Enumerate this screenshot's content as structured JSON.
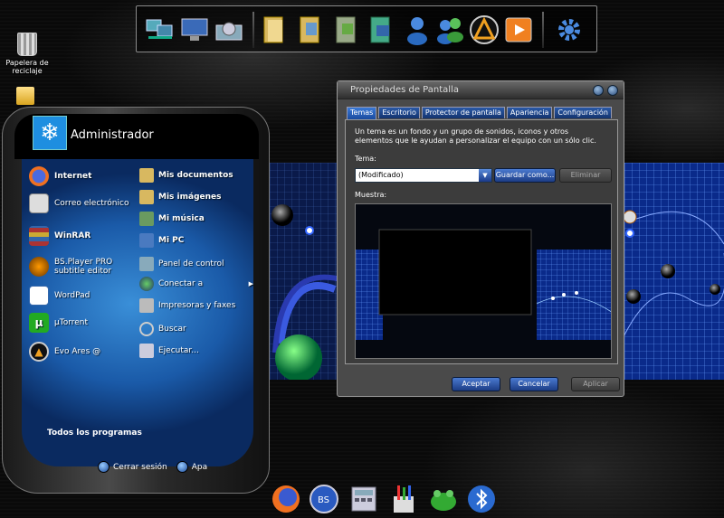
{
  "desktop": {
    "recycle_bin_label": "Papelera de reciclaje"
  },
  "top_dock": {
    "icons": [
      "network-icon",
      "computer-icon",
      "control-panel-icon",
      "folder-icon",
      "documents-icon",
      "folder-icon",
      "video-folder-icon",
      "user-icon",
      "users-icon",
      "ares-icon",
      "media-player-icon",
      "settings-gear-icon"
    ]
  },
  "start_menu": {
    "user_name": "Administrador",
    "left_items": [
      {
        "label": "Internet",
        "icon": "firefox-icon"
      },
      {
        "label": "Correo electrónico",
        "icon": "mail-icon"
      },
      {
        "label": "WinRAR",
        "icon": "winrar-icon"
      },
      {
        "label": "BS.Player PRO subtitle editor",
        "icon": "bsplayer-icon"
      },
      {
        "label": "WordPad",
        "icon": "wordpad-icon"
      },
      {
        "label": "µTorrent",
        "icon": "utorrent-icon"
      },
      {
        "label": "Evo Ares @",
        "icon": "ares-icon"
      }
    ],
    "right_items": [
      {
        "label": "Mis documentos"
      },
      {
        "label": "Mis imágenes"
      },
      {
        "label": "Mi música"
      },
      {
        "label": "Mi PC"
      },
      {
        "label": "Panel de control"
      },
      {
        "label": "Conectar a"
      },
      {
        "label": "Impresoras y faxes"
      },
      {
        "label": "Buscar"
      },
      {
        "label": "Ejecutar..."
      }
    ],
    "all_programs": "Todos los programas",
    "logoff": "Cerrar sesión",
    "shutdown": "Apa"
  },
  "dialog": {
    "title": "Propiedades de Pantalla",
    "tabs": [
      "Temas",
      "Escritorio",
      "Protector de pantalla",
      "Apariencia",
      "Configuración"
    ],
    "description": "Un tema es un fondo y un grupo de sonidos, iconos y otros elementos que le ayudan a personalizar el equipo con un sólo clic.",
    "tema_label": "Tema:",
    "tema_value": "(Modificado)",
    "save_as": "Guardar como...",
    "delete": "Eliminar",
    "preview_label": "Muestra:",
    "accept": "Aceptar",
    "cancel": "Cancelar",
    "apply": "Aplicar"
  },
  "bottom_dock": {
    "icons": [
      "firefox-icon",
      "bsplayer-icon",
      "calculator-icon",
      "paint-icon",
      "frog-icon",
      "bluetooth-icon"
    ]
  },
  "colors": {
    "accent": "#1c4aa0",
    "panel": "#3c3c3c",
    "start_blue": "#2a78c8"
  }
}
